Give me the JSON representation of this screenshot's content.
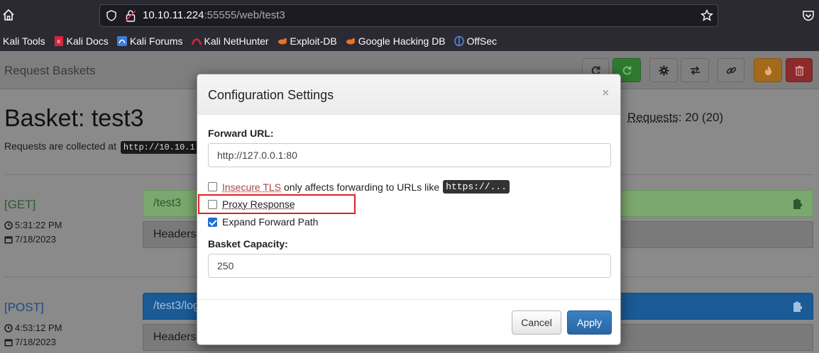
{
  "browser": {
    "url_host": "10.10.11.224",
    "url_path": ":55555/web/test3",
    "bookmarks": [
      {
        "label": "Kali Tools",
        "icon": "kali-icon"
      },
      {
        "label": "Kali Docs",
        "icon": "kali-docs-icon"
      },
      {
        "label": "Kali Forums",
        "icon": "kali-forums-icon"
      },
      {
        "label": "Kali NetHunter",
        "icon": "nethunter-icon"
      },
      {
        "label": "Exploit-DB",
        "icon": "exploit-db-icon"
      },
      {
        "label": "Google Hacking DB",
        "icon": "ghdb-icon"
      },
      {
        "label": "OffSec",
        "icon": "offsec-icon"
      }
    ]
  },
  "app": {
    "brand": "Request Baskets",
    "basket_title": "Basket: test3",
    "requests_label": "Requests",
    "requests_count": ": 20 (20)",
    "collected_text": "Requests are collected at",
    "collected_url": "http://10.10.1",
    "requests": [
      {
        "method": "[GET]",
        "time": "5:31:22 PM",
        "date": "7/18/2023",
        "path": "/test3",
        "headers_label": "Headers",
        "color": "#7ba86e"
      },
      {
        "method": "[POST]",
        "time": "4:53:12 PM",
        "date": "7/18/2023",
        "path": "/test3/log",
        "headers_label": "Headers",
        "color": "#1a5a95"
      }
    ]
  },
  "modal": {
    "title": "Configuration Settings",
    "close": "×",
    "forward_url_label": "Forward URL:",
    "forward_url_value": "http://127.0.0.1:80",
    "insecure_tls_link": "Insecure TLS",
    "insecure_tls_text": "only affects forwarding to URLs like",
    "insecure_tls_code": "https://...",
    "insecure_tls_checked": false,
    "proxy_response_label": "Proxy Response",
    "proxy_response_checked": false,
    "expand_path_label": "Expand Forward Path",
    "expand_path_checked": true,
    "capacity_label": "Basket Capacity:",
    "capacity_value": "250",
    "cancel_label": "Cancel",
    "apply_label": "Apply"
  }
}
